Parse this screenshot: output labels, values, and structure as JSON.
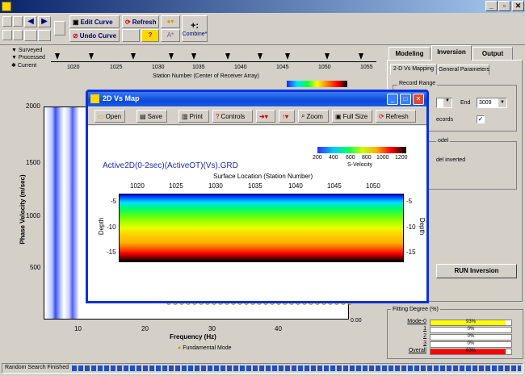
{
  "toolbar": {
    "edit_curve": "Edit Curve",
    "undo_curve": "Undo Curve",
    "refresh": "Refresh",
    "combine": "Combine*"
  },
  "legend": {
    "surveyed": "Surveyed",
    "processed": "Processed",
    "current": "Current"
  },
  "station_axis": {
    "ticks": [
      "1020",
      "1025",
      "1030",
      "1035",
      "1040",
      "1045",
      "1050",
      "1055"
    ],
    "label": "Station Number (Center of Receiver Array)"
  },
  "main_plot": {
    "ylabel": "Phase Velocity (m/sec)",
    "xlabel": "Frequency (Hz)",
    "yticks": [
      "2000",
      "1500",
      "1000",
      "500"
    ],
    "xticks": [
      "10",
      "20",
      "30",
      "40"
    ],
    "right_tick": "0.00",
    "legend": "Fundamental Mode"
  },
  "tabs": {
    "modeling": "Modeling",
    "inversion": "Inversion",
    "output": "Output"
  },
  "subtabs": {
    "vs_mapping": "2-D Vs Mapping",
    "general": "General Parameters"
  },
  "record_range": {
    "title": "Record Range",
    "end_label": "End",
    "end_value": "3009",
    "records": "ecords",
    "model": "odel",
    "model_inverted": "del inverted"
  },
  "run_inversion": "RUN Inversion",
  "fitting": {
    "title": "Fitting Degree (%)",
    "rows": [
      {
        "label": "Mode-0",
        "value": "93%",
        "fill": 0.93,
        "color": "#ffff00"
      },
      {
        "label": "1",
        "value": "0%",
        "fill": 0,
        "color": "#ffff00"
      },
      {
        "label": "2",
        "value": "0%",
        "fill": 0,
        "color": "#ffff00"
      },
      {
        "label": "3",
        "value": "0%",
        "fill": 0,
        "color": "#ffff00"
      },
      {
        "label": "Overall",
        "value": "93%",
        "fill": 0.93,
        "color": "#ff0000"
      }
    ]
  },
  "status": "Random Search Finished",
  "dialog": {
    "title": "2D Vs Map",
    "open": "Open",
    "save": "Save",
    "print": "Print",
    "controls": "Controls",
    "zoom": "Zoom",
    "full_size": "Full Size",
    "refresh": "Refresh",
    "file": "Active2D(0-2sec)(ActiveOT)(Vs).GRD",
    "colorbar_ticks": [
      "200",
      "400",
      "600",
      "800",
      "1000",
      "1200"
    ],
    "colorbar_label": "S-Velocity",
    "x_title": "Surface Location (Station Number)",
    "x_ticks": [
      "1020",
      "1025",
      "1030",
      "1035",
      "1040",
      "1045",
      "1050"
    ],
    "y_ticks": [
      "-5",
      "-10",
      "-15"
    ],
    "y_label": "Depth"
  },
  "colors": {
    "title_bar": "#0a246a",
    "dialog_title": "#1e57d7",
    "link_blue": "#00007a",
    "file_blue": "#1d2ab0"
  }
}
